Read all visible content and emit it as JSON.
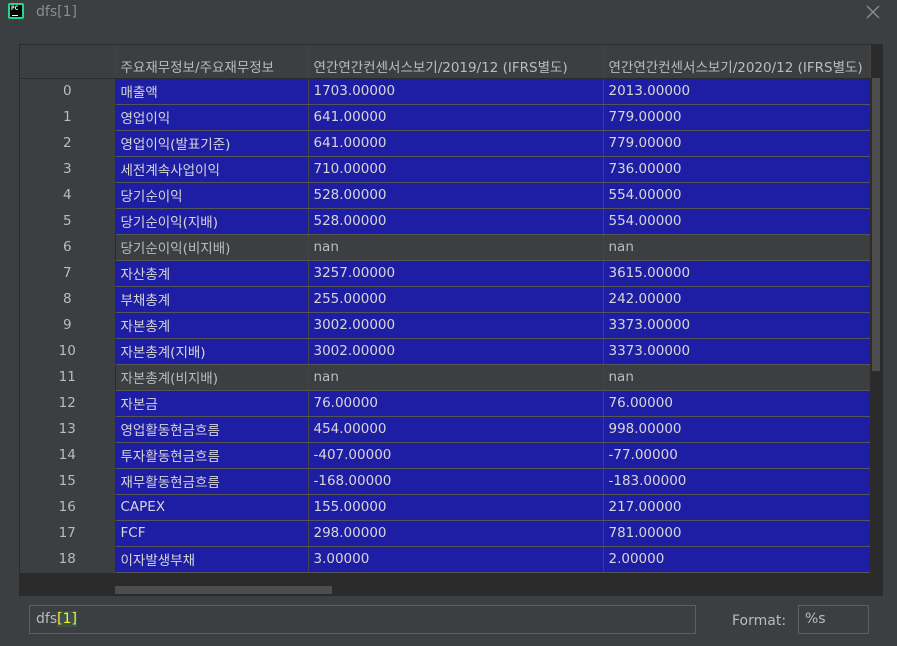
{
  "window": {
    "title": "dfs[1]",
    "app_icon_text": "PC"
  },
  "table": {
    "index_header": "",
    "columns": [
      "주요재무정보/주요재무정보",
      "연간연간컨센서스보기/2019/12  (IFRS별도)",
      "연간연간컨센서스보기/2020/12  (IFRS별도)"
    ],
    "rows": [
      {
        "index": "0",
        "label": "매출액",
        "v2019": "1703.00000",
        "v2020": "2013.00000"
      },
      {
        "index": "1",
        "label": "영업이익",
        "v2019": "641.00000",
        "v2020": "779.00000"
      },
      {
        "index": "2",
        "label": "영업이익(발표기준)",
        "v2019": "641.00000",
        "v2020": "779.00000"
      },
      {
        "index": "3",
        "label": "세전계속사업이익",
        "v2019": "710.00000",
        "v2020": "736.00000"
      },
      {
        "index": "4",
        "label": "당기순이익",
        "v2019": "528.00000",
        "v2020": "554.00000"
      },
      {
        "index": "5",
        "label": "당기순이익(지배)",
        "v2019": "528.00000",
        "v2020": "554.00000"
      },
      {
        "index": "6",
        "label": "당기순이익(비지배)",
        "v2019": "nan",
        "v2020": "nan"
      },
      {
        "index": "7",
        "label": "자산총계",
        "v2019": "3257.00000",
        "v2020": "3615.00000"
      },
      {
        "index": "8",
        "label": "부채총계",
        "v2019": "255.00000",
        "v2020": "242.00000"
      },
      {
        "index": "9",
        "label": "자본총계",
        "v2019": "3002.00000",
        "v2020": "3373.00000"
      },
      {
        "index": "10",
        "label": "자본총계(지배)",
        "v2019": "3002.00000",
        "v2020": "3373.00000"
      },
      {
        "index": "11",
        "label": "자본총계(비지배)",
        "v2019": "nan",
        "v2020": "nan"
      },
      {
        "index": "12",
        "label": "자본금",
        "v2019": "76.00000",
        "v2020": "76.00000"
      },
      {
        "index": "13",
        "label": "영업활동현금흐름",
        "v2019": "454.00000",
        "v2020": "998.00000"
      },
      {
        "index": "14",
        "label": "투자활동현금흐름",
        "v2019": "-407.00000",
        "v2020": "-77.00000"
      },
      {
        "index": "15",
        "label": "재무활동현금흐름",
        "v2019": "-168.00000",
        "v2020": "-183.00000"
      },
      {
        "index": "16",
        "label": "CAPEX",
        "v2019": "155.00000",
        "v2020": "217.00000"
      },
      {
        "index": "17",
        "label": "FCF",
        "v2019": "298.00000",
        "v2020": "781.00000"
      },
      {
        "index": "18",
        "label": "이자발생부채",
        "v2019": "3.00000",
        "v2020": "2.00000"
      }
    ]
  },
  "expression": {
    "prefix": "dfs",
    "bracket": "[1]"
  },
  "format": {
    "label": "Format:",
    "value": "%s"
  },
  "colors": {
    "cell_fill": "#1e1ea5",
    "nan_fill": "#3c3f41",
    "background": "#3c3f41"
  }
}
